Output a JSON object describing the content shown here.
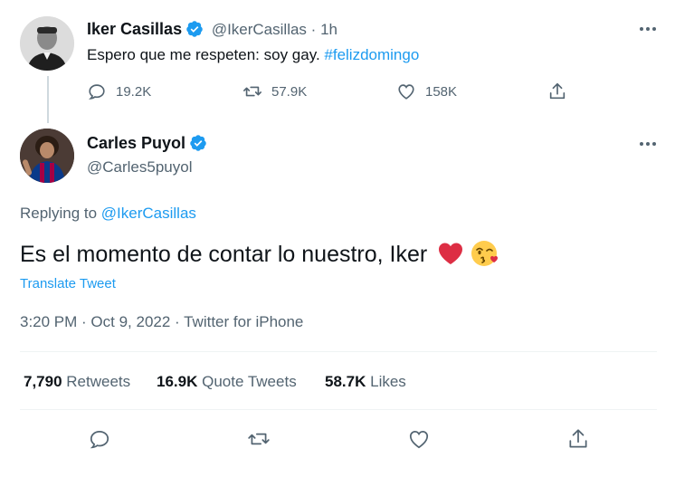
{
  "tweet1": {
    "name": "Iker Casillas",
    "handle": "@IkerCasillas",
    "separator": "·",
    "time": "1h",
    "text_plain": "Espero que me respeten: soy gay. ",
    "hashtag": "#felizdomingo",
    "actions": {
      "reply_count": "19.2K",
      "retweet_count": "57.9K",
      "like_count": "158K"
    }
  },
  "tweet2": {
    "name": "Carles Puyol",
    "handle": "@Carles5puyol",
    "replying_prefix": "Replying to ",
    "replying_handle": "@IkerCasillas",
    "text": "Es el momento de contar lo nuestro, Iker",
    "emoji_heart": "❤️",
    "emoji_kiss": "😘",
    "translate": "Translate Tweet",
    "meta": "3:20 PM · Oct 9, 2022 · Twitter for iPhone",
    "stats": {
      "retweets_value": "7,790",
      "retweets_label": "Retweets",
      "quotes_value": "16.9K",
      "quotes_label": "Quote Tweets",
      "likes_value": "58.7K",
      "likes_label": "Likes"
    }
  },
  "colors": {
    "accent": "#1d9bf0",
    "muted": "#536471",
    "heart": "#e0245e"
  }
}
